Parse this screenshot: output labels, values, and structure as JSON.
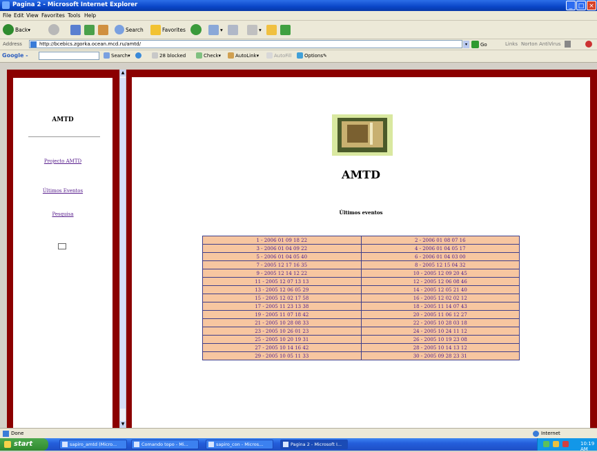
{
  "window": {
    "title": "Pagina 2 - Microsoft Internet Explorer"
  },
  "menu": [
    "File",
    "Edit",
    "View",
    "Favorites",
    "Tools",
    "Help"
  ],
  "toolbar": {
    "back": "Back",
    "search": "Search",
    "favorites": "Favorites"
  },
  "address": {
    "label": "Address",
    "url": "http://bcebics.zgorka.ocean.mcd.ru/amtd/",
    "go": "Go",
    "links": "Links",
    "ext1": "Norton AntiVirus"
  },
  "google": {
    "logo": "Google -",
    "search": "Search",
    "blocked": "28 blocked",
    "check": "Check",
    "autolink": "AutoLink",
    "autofill": "AutoFill",
    "options": "Options"
  },
  "sidebar": {
    "title": "AMTD",
    "links": [
      "Projecto AMTD",
      "Últimos Eventos",
      "Pesquisa"
    ]
  },
  "main": {
    "heading": "AMTD",
    "subtitle": "Últimos eventos",
    "events": [
      [
        "1 - 2006 01 09 18 22",
        "2 - 2006 01 08 07 16"
      ],
      [
        "3 - 2006 01 04 09 22",
        "4 - 2006 01 04 05 17"
      ],
      [
        "5 - 2006 01 04 05 40",
        "6 - 2006 01 04 03 00"
      ],
      [
        "7 - 2005 12 17 16 35",
        "8 - 2005 12 15 04 32"
      ],
      [
        "9 - 2005 12 14 12 22",
        "10 - 2005 12 09 20 45"
      ],
      [
        "11 - 2005 12 07 13 13",
        "12 - 2005 12 06 08 46"
      ],
      [
        "13 - 2005 12 06 05 29",
        "14 - 2005 12 05 21 40"
      ],
      [
        "15 - 2005 12 02 17 58",
        "16 - 2005 12 02 02 12"
      ],
      [
        "17 - 2005 11 23 13 38",
        "18 - 2005 11 14 07 43"
      ],
      [
        "19 - 2005 11 07 18 42",
        "20 - 2005 11 06 12 27"
      ],
      [
        "21 - 2005 10 28 08 33",
        "22 - 2005 10 28 03 18"
      ],
      [
        "23 - 2005 10 26 01 23",
        "24 - 2005 10 24 11 12"
      ],
      [
        "25 - 2005 10 20 19 31",
        "26 - 2005 10 19 23 08"
      ],
      [
        "27 - 2005 10 14 16 42",
        "28 - 2005 10 14 13 12"
      ],
      [
        "29 - 2005 10 05 11 33",
        "30 - 2005 09 28 23 31"
      ]
    ]
  },
  "status": {
    "left": "Done",
    "zone": "Internet"
  },
  "taskbar": {
    "start": "start",
    "buttons": [
      "sapiro_amtd (Micro...",
      "Comando topo - Mi...",
      "sapiro_con - Micros...",
      "Pagina 2 - Microsoft I..."
    ],
    "clock": "10:19 AM"
  }
}
